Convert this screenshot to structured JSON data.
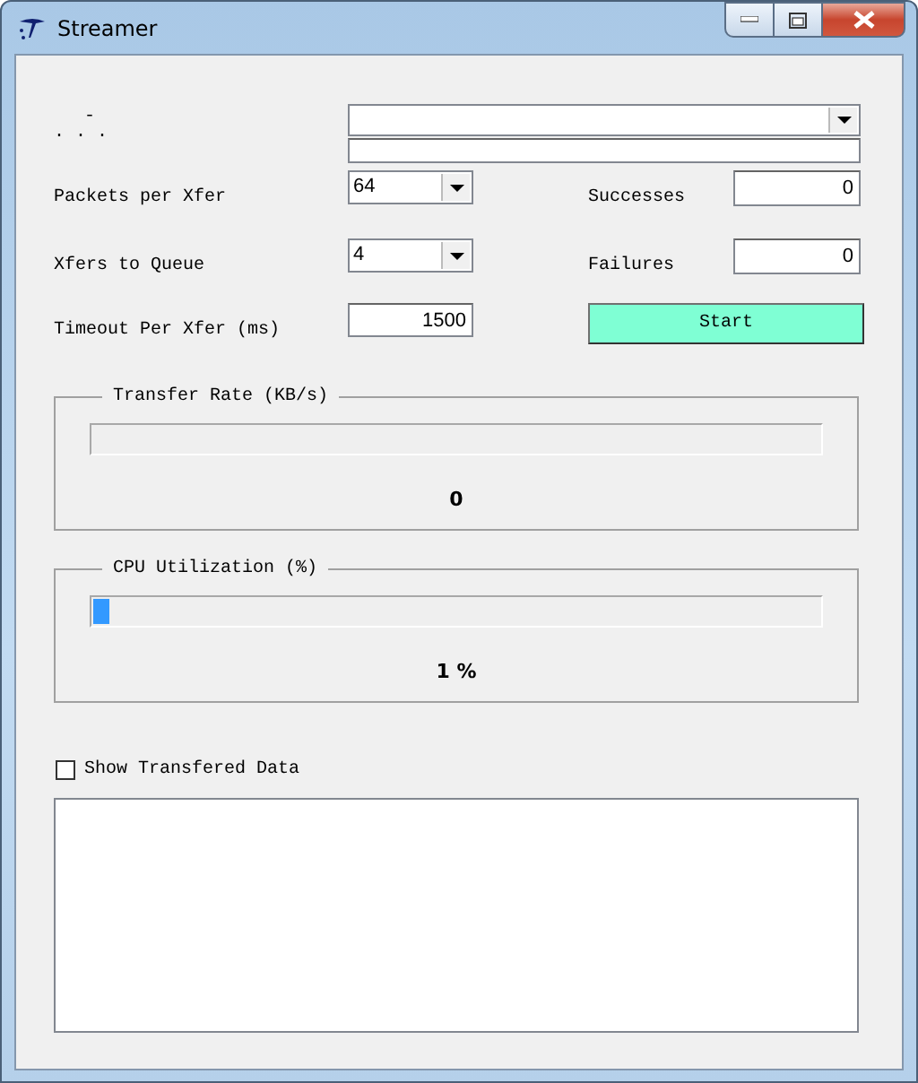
{
  "window": {
    "title": "Streamer"
  },
  "device": {
    "label_top": "-",
    "label_bottom": ". . ."
  },
  "settings": [
    {
      "kind": "combo",
      "label": "Packets per Xfer",
      "value": "64"
    },
    {
      "kind": "combo",
      "label": "Xfers to Queue",
      "value": "4"
    },
    {
      "kind": "field",
      "label": "Timeout Per Xfer (ms)",
      "value": "1500"
    }
  ],
  "counters": [
    {
      "label": "Successes",
      "value": "0"
    },
    {
      "label": "Failures",
      "value": "0"
    }
  ],
  "start_button": "Start",
  "meters": [
    {
      "title": "Transfer Rate (KB/s)",
      "level": 0,
      "reading": "0"
    },
    {
      "title": "CPU Utilization (%)",
      "level": 0.01,
      "reading": "1 %"
    }
  ],
  "show_data": {
    "label": "Show Transfered Data",
    "checked": false
  }
}
